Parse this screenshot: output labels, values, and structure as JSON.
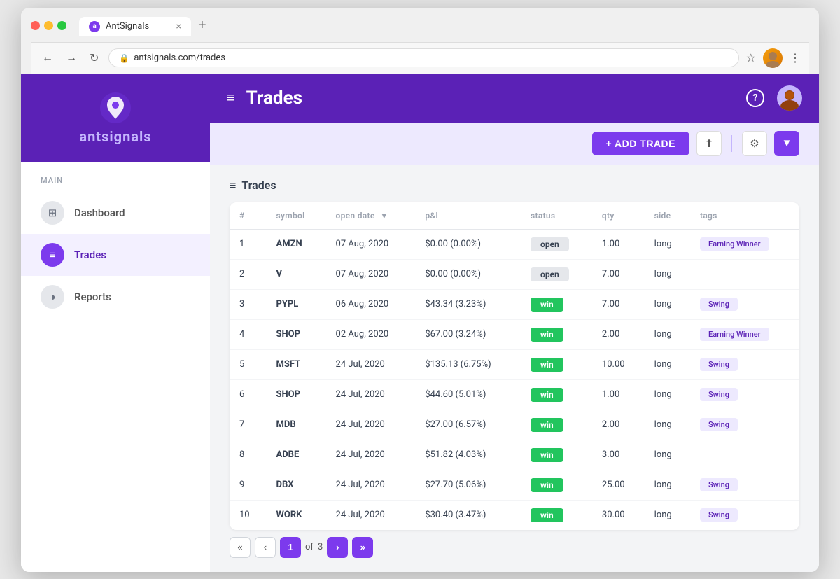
{
  "browser": {
    "tab_title": "AntSignals",
    "tab_close": "×",
    "tab_new": "+",
    "address": "antsignals.com/trades",
    "nav_back": "←",
    "nav_forward": "→",
    "nav_refresh": "↻"
  },
  "sidebar": {
    "logo_text_ant": "ant",
    "logo_text_signals": "signals",
    "nav_section": "MAIN",
    "items": [
      {
        "id": "dashboard",
        "label": "Dashboard",
        "icon": "⊞",
        "active": false
      },
      {
        "id": "trades",
        "label": "Trades",
        "icon": "≡",
        "active": true
      },
      {
        "id": "reports",
        "label": "Reports",
        "icon": "◑",
        "active": false
      }
    ]
  },
  "header": {
    "title": "Trades",
    "help_icon": "?",
    "hamburger": "≡"
  },
  "toolbar": {
    "add_trade_label": "+ ADD TRADE",
    "upload_icon": "↑",
    "settings_icon": "⚙",
    "filter_icon": "⊿"
  },
  "table": {
    "title": "Trades",
    "title_icon": "≡",
    "columns": [
      "#",
      "symbol",
      "open date",
      "p&l",
      "status",
      "qty",
      "side",
      "tags"
    ],
    "rows": [
      {
        "num": 1,
        "symbol": "AMZN",
        "open_date": "07 Aug, 2020",
        "pnl": "$0.00 (0.00%)",
        "pnl_type": "neutral",
        "status": "open",
        "qty": "1.00",
        "side": "long",
        "tags": [
          "Earning Winner"
        ]
      },
      {
        "num": 2,
        "symbol": "V",
        "open_date": "07 Aug, 2020",
        "pnl": "$0.00 (0.00%)",
        "pnl_type": "neutral",
        "status": "open",
        "qty": "7.00",
        "side": "long",
        "tags": []
      },
      {
        "num": 3,
        "symbol": "PYPL",
        "open_date": "06 Aug, 2020",
        "pnl": "$43.34 (3.23%)",
        "pnl_type": "green",
        "status": "win",
        "qty": "7.00",
        "side": "long",
        "tags": [
          "Swing"
        ]
      },
      {
        "num": 4,
        "symbol": "SHOP",
        "open_date": "02 Aug, 2020",
        "pnl": "$67.00 (3.24%)",
        "pnl_type": "green",
        "status": "win",
        "qty": "2.00",
        "side": "long",
        "tags": [
          "Earning Winner"
        ]
      },
      {
        "num": 5,
        "symbol": "MSFT",
        "open_date": "24 Jul, 2020",
        "pnl": "$135.13 (6.75%)",
        "pnl_type": "green",
        "status": "win",
        "qty": "10.00",
        "side": "long",
        "tags": [
          "Swing"
        ]
      },
      {
        "num": 6,
        "symbol": "SHOP",
        "open_date": "24 Jul, 2020",
        "pnl": "$44.60 (5.01%)",
        "pnl_type": "green",
        "status": "win",
        "qty": "1.00",
        "side": "long",
        "tags": [
          "Swing"
        ]
      },
      {
        "num": 7,
        "symbol": "MDB",
        "open_date": "24 Jul, 2020",
        "pnl": "$27.00 (6.57%)",
        "pnl_type": "green",
        "status": "win",
        "qty": "2.00",
        "side": "long",
        "tags": [
          "Swing"
        ]
      },
      {
        "num": 8,
        "symbol": "ADBE",
        "open_date": "24 Jul, 2020",
        "pnl": "$51.82 (4.03%)",
        "pnl_type": "green",
        "status": "win",
        "qty": "3.00",
        "side": "long",
        "tags": []
      },
      {
        "num": 9,
        "symbol": "DBX",
        "open_date": "24 Jul, 2020",
        "pnl": "$27.70 (5.06%)",
        "pnl_type": "green",
        "status": "win",
        "qty": "25.00",
        "side": "long",
        "tags": [
          "Swing"
        ]
      },
      {
        "num": 10,
        "symbol": "WORK",
        "open_date": "24 Jul, 2020",
        "pnl": "$30.40 (3.47%)",
        "pnl_type": "green",
        "status": "win",
        "qty": "30.00",
        "side": "long",
        "tags": [
          "Swing"
        ]
      }
    ]
  },
  "pagination": {
    "current_page": "1",
    "total_pages": "3",
    "of_label": "of",
    "first_icon": "«",
    "prev_icon": "‹",
    "next_icon": "›",
    "last_icon": "»"
  },
  "colors": {
    "purple_primary": "#7c3aed",
    "purple_dark": "#5b21b6",
    "purple_light": "#ede9fe",
    "green": "#22c55e",
    "gray_badge": "#e5e7eb"
  }
}
